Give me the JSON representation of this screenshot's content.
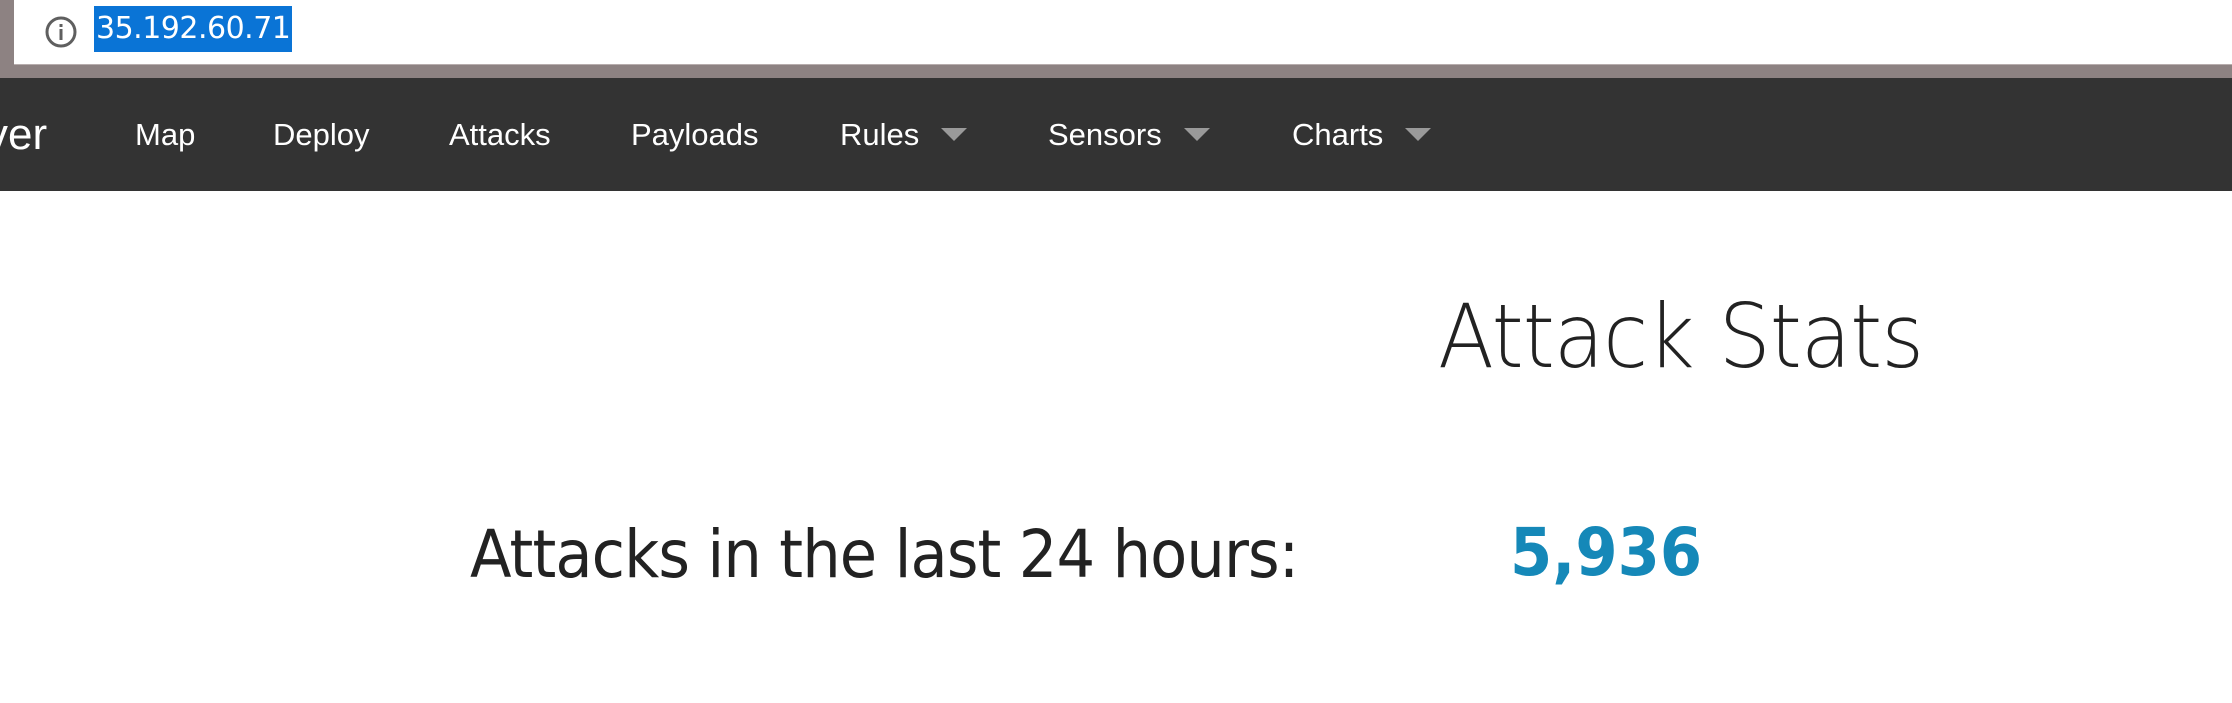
{
  "browser": {
    "url": "35.192.60.71",
    "info_icon": "info-icon"
  },
  "navbar": {
    "brand": "ver",
    "items": [
      {
        "label": "Map"
      },
      {
        "label": "Deploy"
      },
      {
        "label": "Attacks"
      },
      {
        "label": "Payloads"
      },
      {
        "label": "Rules",
        "icon": "caret-down-icon"
      },
      {
        "label": "Sensors",
        "icon": "caret-down-icon"
      },
      {
        "label": "Charts",
        "icon": "caret-down-icon"
      }
    ]
  },
  "main": {
    "title": "Attack Stats",
    "stat_label": "Attacks in the last 24 hours:",
    "stat_value": "5,936"
  },
  "colors": {
    "navbar_bg": "#333333",
    "accent": "#1588b8",
    "url_highlight": "#0a74d6"
  }
}
